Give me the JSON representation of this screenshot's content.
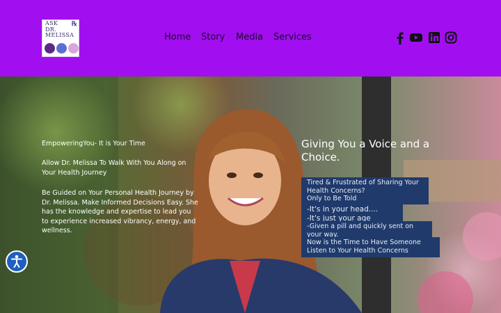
{
  "logo": {
    "line1": "ASK",
    "line2": "DR. MELISSA",
    "rx": "℞"
  },
  "nav": {
    "items": [
      {
        "label": "Home"
      },
      {
        "label": "Story"
      },
      {
        "label": "Media"
      },
      {
        "label": "Services"
      }
    ]
  },
  "social": [
    "facebook-icon",
    "youtube-icon",
    "linkedin-icon",
    "instagram-icon"
  ],
  "hero": {
    "tagline": "EmpoweringYou- It is Your Time",
    "intro": "Allow Dr. Melissa To Walk With You Along on Your Health Journey",
    "body": "Be Guided on Your Personal Health Journey by Dr. Melissa. Make Informed Decisions Easy. She has the knowledge and expertise to lead you to experience increased vibrancy, energy, and wellness.",
    "headline": "Giving You a Voice and a Choice.",
    "box1": "Tired & Frustrated of Sharing Your Health Concerns?\nOnly to Be Told",
    "box2": "-It's in your head....\n-It's just your age",
    "box3": "-Given a pill and quickly sent on your way.",
    "box4": "Now is the Time to Have Someone Listen to Your Health Concerns"
  },
  "colors": {
    "header": "#a10ff0",
    "box": "#1f3a6b",
    "accessibility": "#1f5fbf"
  }
}
